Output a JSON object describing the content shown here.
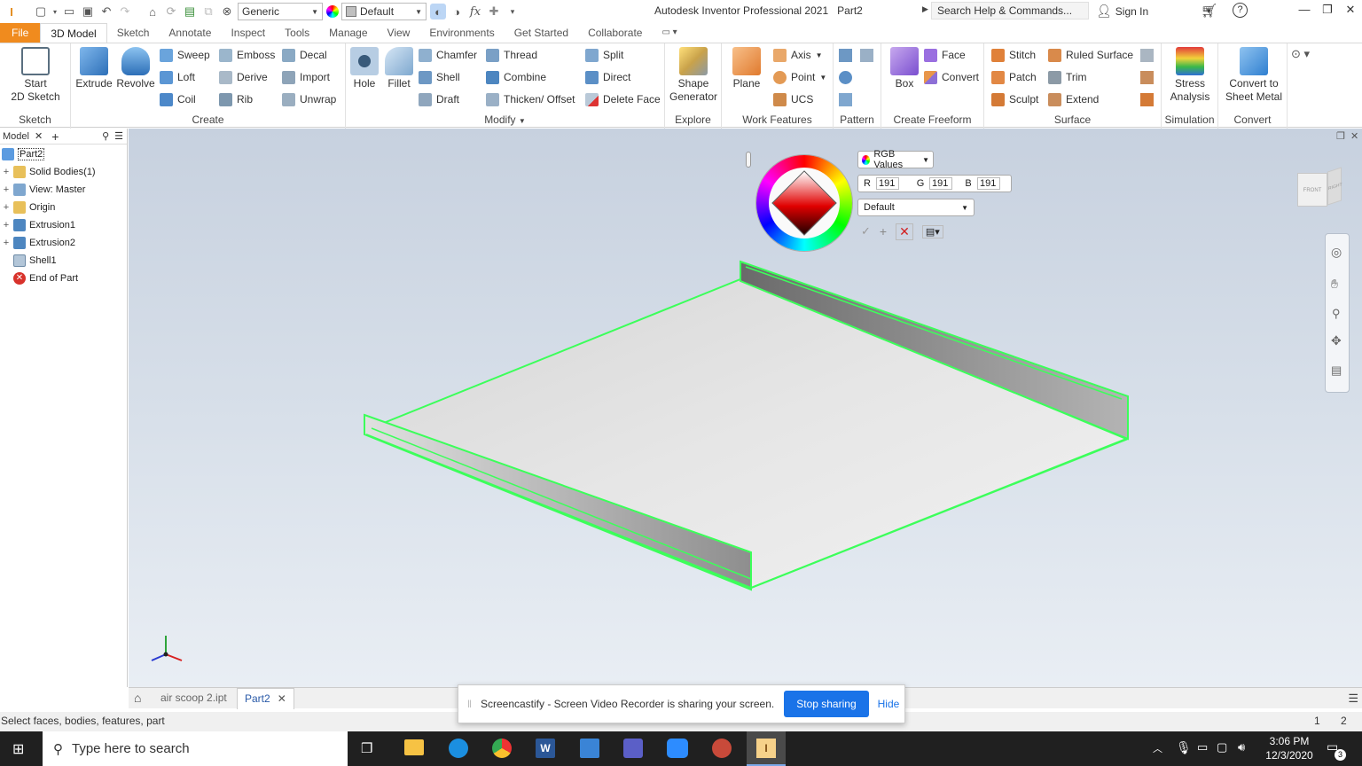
{
  "app": {
    "title": "Autodesk Inventor Professional 2021",
    "document": "Part2"
  },
  "quick_access": {
    "material": "Generic",
    "appearance": "Default",
    "fx_label": "fx"
  },
  "search": {
    "placeholder": "Search Help & Commands..."
  },
  "account": {
    "sign_in": "Sign In",
    "help": "?"
  },
  "tabs": [
    "File",
    "3D Model",
    "Sketch",
    "Annotate",
    "Inspect",
    "Tools",
    "Manage",
    "View",
    "Environments",
    "Get Started",
    "Collaborate"
  ],
  "active_tab": "3D Model",
  "ribbon": {
    "sketch": {
      "label": "Sketch",
      "start_line1": "Start",
      "start_line2": "2D Sketch"
    },
    "create": {
      "label": "Create",
      "extrude": "Extrude",
      "revolve": "Revolve",
      "sweep": "Sweep",
      "emboss": "Emboss",
      "decal": "Decal",
      "loft": "Loft",
      "derive": "Derive",
      "import": "Import",
      "coil": "Coil",
      "rib": "Rib",
      "unwrap": "Unwrap"
    },
    "modify": {
      "label": "Modify",
      "hole": "Hole",
      "fillet": "Fillet",
      "chamfer": "Chamfer",
      "thread": "Thread",
      "split": "Split",
      "shell": "Shell",
      "combine": "Combine",
      "direct": "Direct",
      "draft": "Draft",
      "thicken": "Thicken/ Offset",
      "delete_face": "Delete Face"
    },
    "explore": {
      "label": "Explore",
      "shape_line1": "Shape",
      "shape_line2": "Generator"
    },
    "work_features": {
      "label": "Work Features",
      "plane": "Plane",
      "axis": "Axis",
      "point": "Point",
      "ucs": "UCS"
    },
    "pattern": {
      "label": "Pattern"
    },
    "freeform": {
      "label": "Create Freeform",
      "box": "Box",
      "face": "Face",
      "convert": "Convert"
    },
    "surface": {
      "label": "Surface",
      "stitch": "Stitch",
      "ruled": "Ruled Surface",
      "patch": "Patch",
      "trim": "Trim",
      "sculpt": "Sculpt",
      "extend": "Extend"
    },
    "simulation": {
      "label": "Simulation",
      "stress_line1": "Stress",
      "stress_line2": "Analysis"
    },
    "convert": {
      "label": "Convert",
      "sm_line1": "Convert to",
      "sm_line2": "Sheet Metal"
    }
  },
  "browser": {
    "tab": "Model",
    "root": "Part2",
    "nodes": [
      {
        "label": "Solid Bodies(1)",
        "expand": "+"
      },
      {
        "label": "View: Master",
        "expand": "+"
      },
      {
        "label": "Origin",
        "expand": "+"
      },
      {
        "label": "Extrusion1",
        "expand": "+"
      },
      {
        "label": "Extrusion2",
        "expand": "+"
      },
      {
        "label": "Shell1",
        "expand": ""
      },
      {
        "label": "End of Part",
        "expand": ""
      }
    ]
  },
  "color_picker": {
    "mode": "RGB Values",
    "r_label": "R",
    "r": "191",
    "g_label": "G",
    "g": "191",
    "b_label": "B",
    "b": "191",
    "preset": "Default"
  },
  "viewcube": {
    "front": "FRONT",
    "right": "RIGHT"
  },
  "doc_tabs": [
    "air scoop 2.ipt",
    "Part2"
  ],
  "status": {
    "text": "Select faces, bodies, features, part",
    "count1": "1",
    "count2": "2"
  },
  "notification": {
    "text": "Screencastify - Screen Video Recorder is sharing your screen.",
    "stop": "Stop sharing",
    "hide": "Hide"
  },
  "taskbar": {
    "search": "Type here to search",
    "time": "3:06 PM",
    "date": "12/3/2020",
    "badge": "3"
  },
  "colors": {
    "file_tab": "#f08b1e",
    "highlight": "#3cff5a",
    "stop_button": "#1a73e8"
  }
}
